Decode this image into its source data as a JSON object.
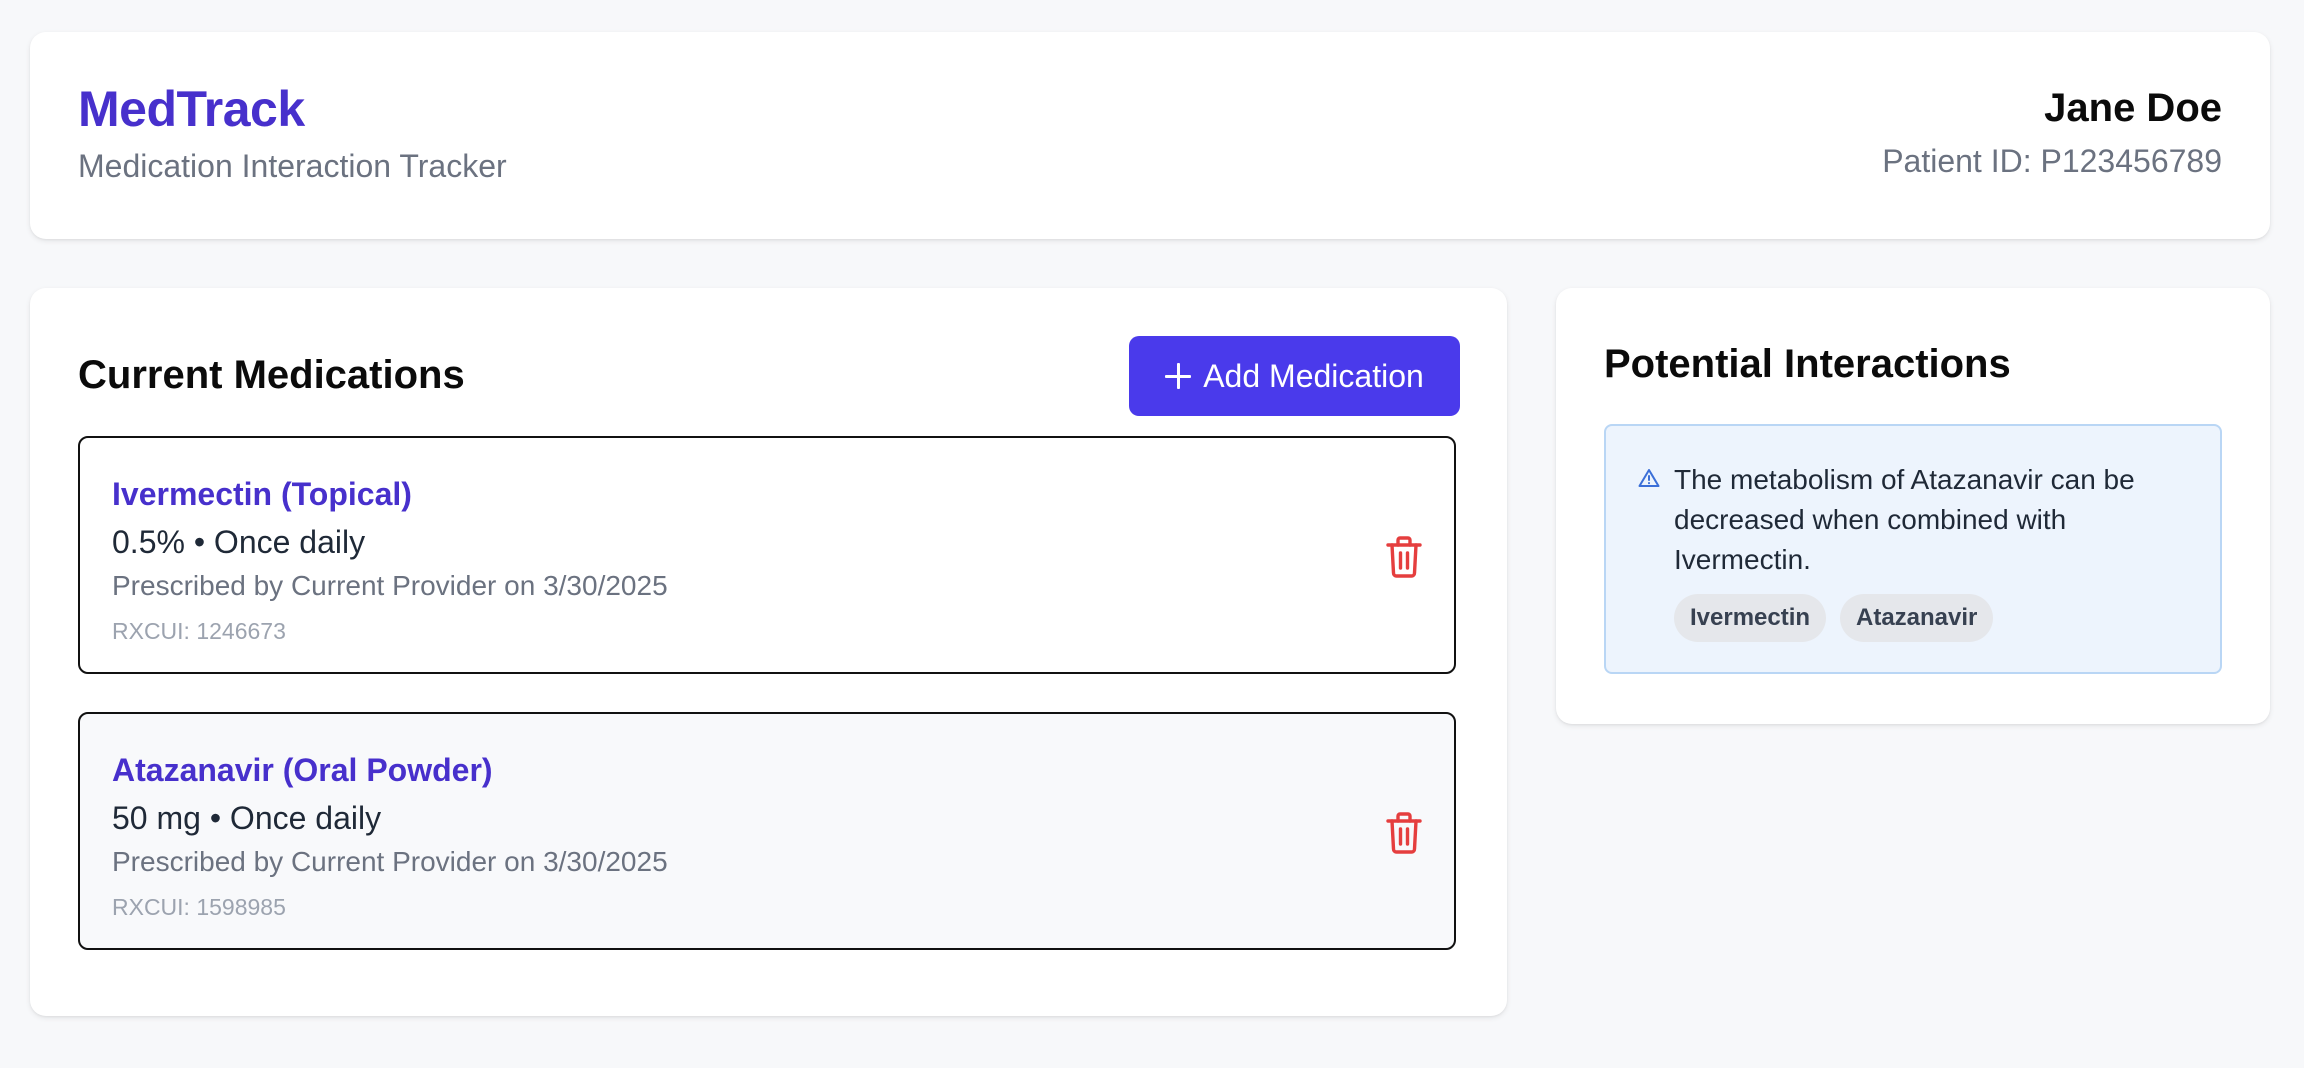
{
  "header": {
    "app_name": "MedTrack",
    "app_subtitle": "Medication Interaction Tracker",
    "patient_name": "Jane Doe",
    "patient_id": "Patient ID: P123456789"
  },
  "medications": {
    "heading": "Current Medications",
    "add_button_label": "Add Medication",
    "items": [
      {
        "name": "Ivermectin (Topical)",
        "dose_frequency": "0.5% • Once daily",
        "prescribed": "Prescribed by Current Provider on 3/30/2025",
        "rxcui": "RXCUI: 1246673"
      },
      {
        "name": "Atazanavir (Oral Powder)",
        "dose_frequency": "50 mg • Once daily",
        "prescribed": "Prescribed by Current Provider on 3/30/2025",
        "rxcui": "RXCUI: 1598985"
      }
    ]
  },
  "interactions": {
    "heading": "Potential Interactions",
    "items": [
      {
        "description": "The metabolism of Atazanavir can be decreased when combined with Ivermectin.",
        "drugs": [
          "Ivermectin",
          "Atazanavir"
        ]
      }
    ]
  },
  "icons": {
    "add": "plus-icon",
    "delete": "trash-icon",
    "warning": "warning-triangle-icon"
  },
  "colors": {
    "brand": "#4730cc",
    "button": "#4a3aeb",
    "delete": "#e53e3e",
    "alert_bg": "#edf4fd",
    "alert_border": "#b9d6f5",
    "alert_icon": "#3b6fd8"
  }
}
